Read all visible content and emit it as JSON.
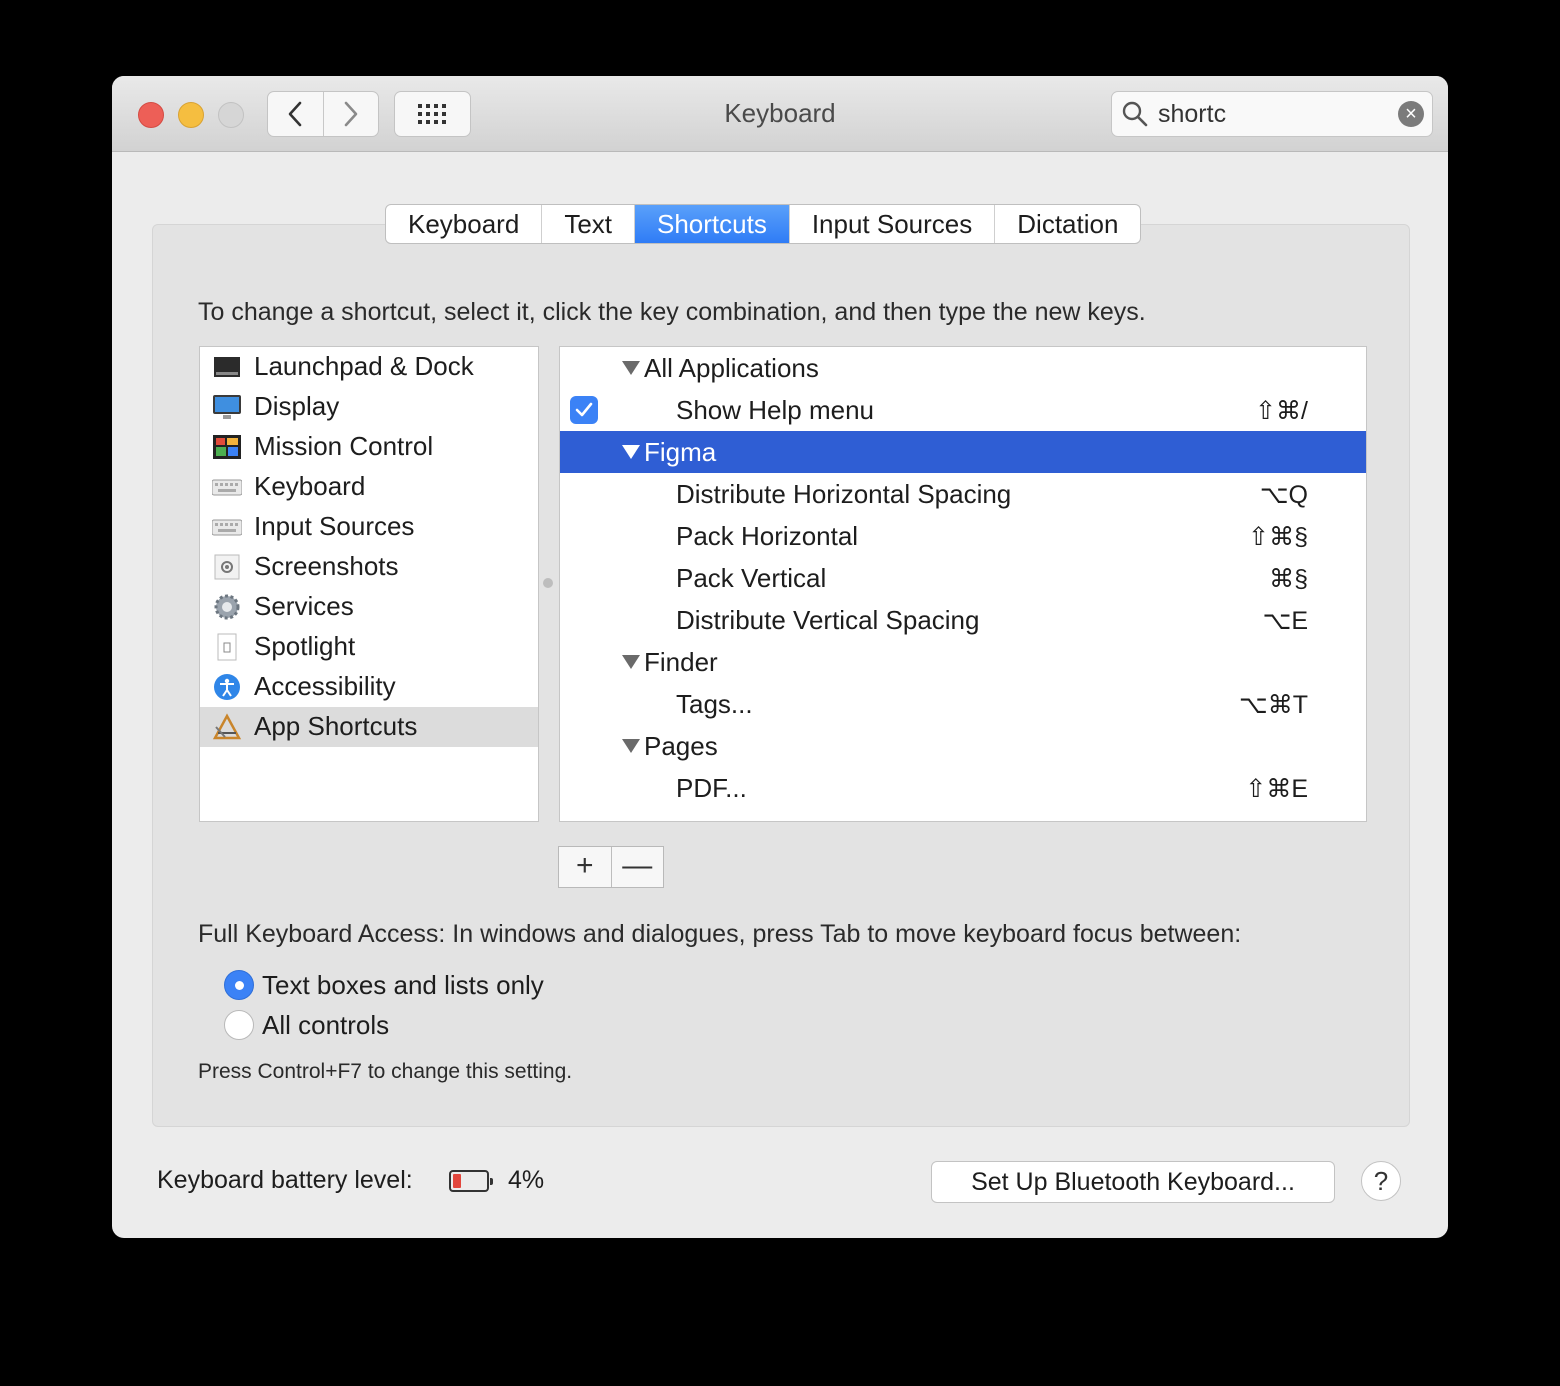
{
  "window": {
    "title": "Keyboard"
  },
  "search": {
    "value": "shortc"
  },
  "tabs": [
    {
      "label": "Keyboard",
      "active": false
    },
    {
      "label": "Text",
      "active": false
    },
    {
      "label": "Shortcuts",
      "active": true
    },
    {
      "label": "Input Sources",
      "active": false
    },
    {
      "label": "Dictation",
      "active": false
    }
  ],
  "instruction": "To change a shortcut, select it, click the key combination, and then type the new keys.",
  "categories": [
    {
      "label": "Launchpad & Dock",
      "icon": "launchpad-dock-icon"
    },
    {
      "label": "Display",
      "icon": "display-icon"
    },
    {
      "label": "Mission Control",
      "icon": "mission-control-icon"
    },
    {
      "label": "Keyboard",
      "icon": "keyboard-icon"
    },
    {
      "label": "Input Sources",
      "icon": "input-sources-icon"
    },
    {
      "label": "Screenshots",
      "icon": "screenshots-icon"
    },
    {
      "label": "Services",
      "icon": "services-gear-icon"
    },
    {
      "label": "Spotlight",
      "icon": "spotlight-icon"
    },
    {
      "label": "Accessibility",
      "icon": "accessibility-icon"
    },
    {
      "label": "App Shortcuts",
      "icon": "app-shortcuts-icon",
      "selected": true
    }
  ],
  "shortcuts": [
    {
      "type": "group",
      "label": "All Applications"
    },
    {
      "type": "item",
      "label": "Show Help menu",
      "keys": "⇧⌘/",
      "checked": true
    },
    {
      "type": "group",
      "label": "Figma",
      "selected": true
    },
    {
      "type": "item",
      "label": "Distribute Horizontal Spacing",
      "keys": "⌥Q"
    },
    {
      "type": "item",
      "label": "Pack Horizontal",
      "keys": "⇧⌘§"
    },
    {
      "type": "item",
      "label": "Pack Vertical",
      "keys": "⌘§"
    },
    {
      "type": "item",
      "label": "Distribute Vertical Spacing",
      "keys": "⌥E"
    },
    {
      "type": "group",
      "label": "Finder"
    },
    {
      "type": "item",
      "label": "Tags...",
      "keys": "⌥⌘T"
    },
    {
      "type": "group",
      "label": "Pages"
    },
    {
      "type": "item",
      "label": "PDF...",
      "keys": "⇧⌘E"
    }
  ],
  "buttons": {
    "add": "+",
    "remove": "—"
  },
  "full_keyboard_access": {
    "label": "Full Keyboard Access: In windows and dialogues, press Tab to move keyboard focus between:",
    "options": [
      {
        "label": "Text boxes and lists only",
        "selected": true
      },
      {
        "label": "All controls",
        "selected": false
      }
    ],
    "hint": "Press Control+F7 to change this setting."
  },
  "battery": {
    "label": "Keyboard battery level:",
    "percent": "4%",
    "level": 0.04,
    "color": "#e2463c"
  },
  "bluetooth_button": "Set Up Bluetooth Keyboard...",
  "help_button": "?",
  "accent_color": "#2f5ed4"
}
